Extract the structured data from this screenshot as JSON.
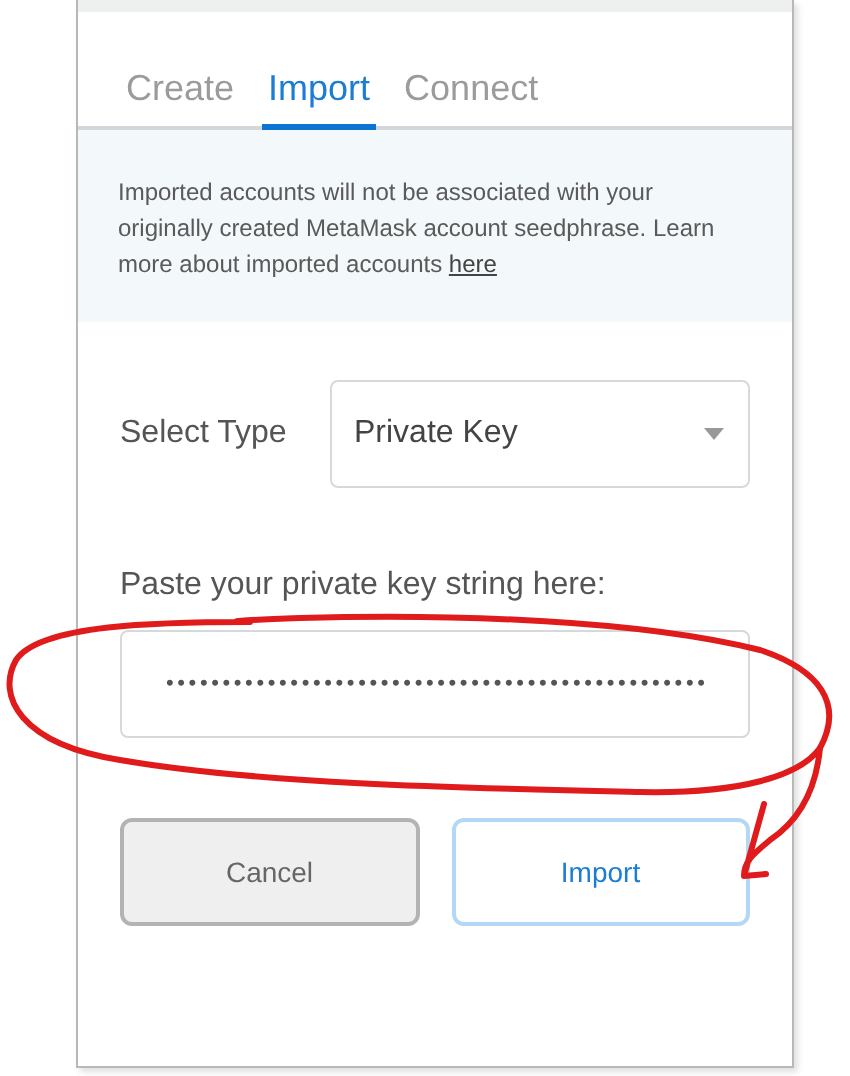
{
  "tabs": [
    {
      "label": "Create",
      "selected": false
    },
    {
      "label": "Import",
      "selected": true
    },
    {
      "label": "Connect",
      "selected": false
    }
  ],
  "notice": {
    "text": "Imported accounts will not be associated with your originally created MetaMask account seedphrase. Learn more about imported accounts ",
    "link": "here"
  },
  "select_type": {
    "label": "Select Type",
    "value": "Private Key"
  },
  "key_field": {
    "label": "Paste your private key string here:",
    "value": "••••••••••••••••••••••••••••••••••••••••••••••••"
  },
  "buttons": [
    {
      "label": "Cancel",
      "kind": "secondary"
    },
    {
      "label": "Import",
      "kind": "primary"
    }
  ]
}
